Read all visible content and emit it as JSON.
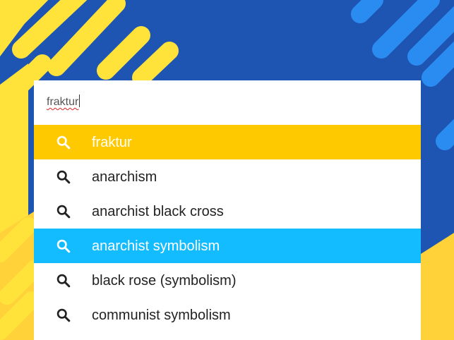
{
  "search": {
    "value": "fraktur",
    "icon": "search-icon"
  },
  "suggestions": [
    {
      "label": "fraktur",
      "highlight": "yellow"
    },
    {
      "label": "anarchism",
      "highlight": "none"
    },
    {
      "label": "anarchist black cross",
      "highlight": "none"
    },
    {
      "label": "anarchist symbolism",
      "highlight": "blue"
    },
    {
      "label": "black rose (symbolism)",
      "highlight": "none"
    },
    {
      "label": "communist symbolism",
      "highlight": "none"
    }
  ],
  "colors": {
    "background": "#1e55b2",
    "highlight_yellow": "#ffc900",
    "highlight_blue": "#13bcff",
    "stripes_yellow": "#ffe23a",
    "stripes_blue": "#2a8cf0",
    "text": "#222222",
    "text_on_highlight": "#ffffff"
  }
}
